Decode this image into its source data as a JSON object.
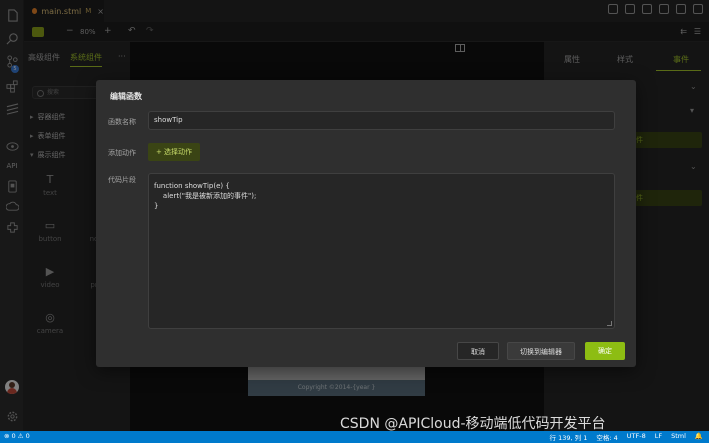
{
  "tab": {
    "filename": "main.stml",
    "modified": "M",
    "close": "×"
  },
  "toolbar": {
    "minus": "−",
    "zoom": "80%",
    "plus": "+",
    "undo": "↶",
    "redo": "↷",
    "right1": "⇇",
    "right2": "☰"
  },
  "activity": {
    "badge": "5",
    "api": "API"
  },
  "left_panel": {
    "tabs": [
      "高级组件",
      "系统组件"
    ],
    "active_tab": 1,
    "more": "···",
    "search_placeholder": "搜索",
    "groups": [
      "容器组件",
      "表单组件",
      "展示组件"
    ],
    "components": [
      {
        "icon": "T",
        "label": "text"
      },
      {
        "icon": "▭",
        "label": "button"
      },
      {
        "icon": "▶",
        "label": "video"
      },
      {
        "icon": "◎",
        "label": "camera"
      }
    ],
    "partial_labels": [
      "no",
      "pr"
    ]
  },
  "canvas": {
    "footer": "Copyright ©2014-{year }"
  },
  "right_panel": {
    "tabs": [
      "属性",
      "样式",
      "事件"
    ],
    "active_tab": 2,
    "btn1": "件",
    "btn2": "件"
  },
  "dialog": {
    "title": "编辑函数",
    "function_name_label": "函数名称",
    "function_name_value": "showTip",
    "add_action_label": "添加动作",
    "add_action_button": "+ 选择动作",
    "code_label": "代码片段",
    "code_lines": [
      "function showTip(e) {",
      "    alert(\"我是被新添加的事件\");",
      "}"
    ],
    "cancel": "取消",
    "switch_editor": "切换到编辑器",
    "confirm": "确定"
  },
  "status": {
    "left": "⊗ 0 ⚠ 0",
    "position": "行 139, 列 1",
    "spaces": "空格: 4",
    "encoding": "UTF-8",
    "eol": "LF",
    "lang": "Stml",
    "bell": "🔔"
  },
  "watermark": "CSDN @APICloud-移动端低代码开发平台",
  "colors": {
    "accent": "#a3c42a",
    "confirm": "#8dbd13",
    "status": "#007acc"
  }
}
